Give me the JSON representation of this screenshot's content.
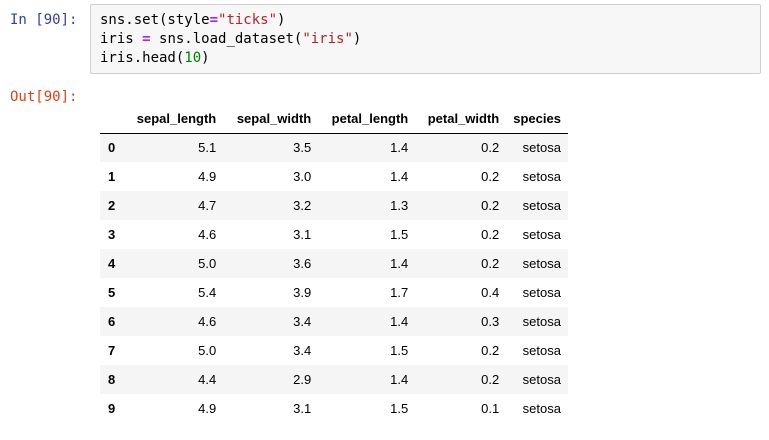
{
  "cells": {
    "input_prompt": "In [90]:",
    "output_prompt": "Out[90]:",
    "code_lines": [
      "sns.set(style=\"ticks\")",
      "iris = sns.load_dataset(\"iris\")",
      "iris.head(10)"
    ],
    "code_tokens": {
      "line1_a": "sns.set(style",
      "line1_op": "=",
      "line1_str": "\"ticks\"",
      "line1_b": ")",
      "line2_a": "iris ",
      "line2_op": "=",
      "line2_b": " sns.load_dataset(",
      "line2_str": "\"iris\"",
      "line2_c": ")",
      "line3_a": "iris.head(",
      "line3_num": "10",
      "line3_b": ")"
    }
  },
  "dataframe": {
    "columns": [
      "",
      "sepal_length",
      "sepal_width",
      "petal_length",
      "petal_width",
      "species"
    ],
    "rows": [
      {
        "index": "0",
        "sepal_length": "5.1",
        "sepal_width": "3.5",
        "petal_length": "1.4",
        "petal_width": "0.2",
        "species": "setosa"
      },
      {
        "index": "1",
        "sepal_length": "4.9",
        "sepal_width": "3.0",
        "petal_length": "1.4",
        "petal_width": "0.2",
        "species": "setosa"
      },
      {
        "index": "2",
        "sepal_length": "4.7",
        "sepal_width": "3.2",
        "petal_length": "1.3",
        "petal_width": "0.2",
        "species": "setosa"
      },
      {
        "index": "3",
        "sepal_length": "4.6",
        "sepal_width": "3.1",
        "petal_length": "1.5",
        "petal_width": "0.2",
        "species": "setosa"
      },
      {
        "index": "4",
        "sepal_length": "5.0",
        "sepal_width": "3.6",
        "petal_length": "1.4",
        "petal_width": "0.2",
        "species": "setosa"
      },
      {
        "index": "5",
        "sepal_length": "5.4",
        "sepal_width": "3.9",
        "petal_length": "1.7",
        "petal_width": "0.4",
        "species": "setosa"
      },
      {
        "index": "6",
        "sepal_length": "4.6",
        "sepal_width": "3.4",
        "petal_length": "1.4",
        "petal_width": "0.3",
        "species": "setosa"
      },
      {
        "index": "7",
        "sepal_length": "5.0",
        "sepal_width": "3.4",
        "petal_length": "1.5",
        "petal_width": "0.2",
        "species": "setosa"
      },
      {
        "index": "8",
        "sepal_length": "4.4",
        "sepal_width": "2.9",
        "petal_length": "1.4",
        "petal_width": "0.2",
        "species": "setosa"
      },
      {
        "index": "9",
        "sepal_length": "4.9",
        "sepal_width": "3.1",
        "petal_length": "1.5",
        "petal_width": "0.1",
        "species": "setosa"
      }
    ]
  },
  "colors": {
    "input_prompt": "#303f9f",
    "output_prompt": "#d84315",
    "string": "#ba2121",
    "operator": "#aa22ff",
    "number": "#008000",
    "input_background": "#f7f7f7",
    "striped_row": "#f5f5f5"
  }
}
